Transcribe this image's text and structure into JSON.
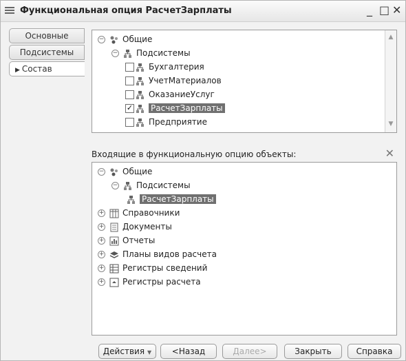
{
  "window": {
    "title": "Функциональная опция РасчетЗарплаты",
    "minimize": "_",
    "maximize": "□",
    "close": "✕"
  },
  "tabs": [
    {
      "label": "Основные"
    },
    {
      "label": "Подсистемы"
    },
    {
      "label": "Состав",
      "active": true
    }
  ],
  "top_tree": [
    {
      "label": "Общие",
      "icon": "common-icon",
      "level": 0,
      "expander": "⊖"
    },
    {
      "label": "Подсистемы",
      "icon": "subsystems-icon",
      "level": 1,
      "expander": "⊖"
    },
    {
      "label": "Бухгалтерия",
      "icon": "subsystem-icon",
      "level": 2,
      "checked": false
    },
    {
      "label": "УчетМатериалов",
      "icon": "subsystem-icon",
      "level": 2,
      "checked": false
    },
    {
      "label": "ОказаниеУслуг",
      "icon": "subsystem-icon",
      "level": 2,
      "checked": false
    },
    {
      "label": "РасчетЗарплаты",
      "icon": "subsystem-icon",
      "level": 2,
      "checked": true,
      "selected": true
    },
    {
      "label": "Предприятие",
      "icon": "subsystem-icon",
      "level": 2,
      "checked": false
    }
  ],
  "section_label": "Входящие в функциональную опцию объекты:",
  "bottom_tree": [
    {
      "label": "Общие",
      "icon": "common-icon",
      "level": 0,
      "expander": "⊖"
    },
    {
      "label": "Подсистемы",
      "icon": "subsystems-icon",
      "level": 1,
      "expander": "⊖"
    },
    {
      "label": "РасчетЗарплаты",
      "icon": "subsystem-icon",
      "level": 2,
      "selected": true
    },
    {
      "label": "Справочники",
      "icon": "catalog-icon",
      "level": 0,
      "expander": "⊕"
    },
    {
      "label": "Документы",
      "icon": "document-icon",
      "level": 0,
      "expander": "⊕"
    },
    {
      "label": "Отчеты",
      "icon": "report-icon",
      "level": 0,
      "expander": "⊕"
    },
    {
      "label": "Планы видов расчета",
      "icon": "calc-plan-icon",
      "level": 0,
      "expander": "⊕"
    },
    {
      "label": "Регистры сведений",
      "icon": "info-register-icon",
      "level": 0,
      "expander": "⊕"
    },
    {
      "label": "Регистры расчета",
      "icon": "calc-register-icon",
      "level": 0,
      "expander": "⊕"
    }
  ],
  "buttons": {
    "actions": "Действия",
    "back": "<Назад",
    "next": "Далее>",
    "close": "Закрыть",
    "help": "Справка"
  },
  "colors": {
    "selection": "#707070",
    "window_bg": "#f2f2f2"
  }
}
